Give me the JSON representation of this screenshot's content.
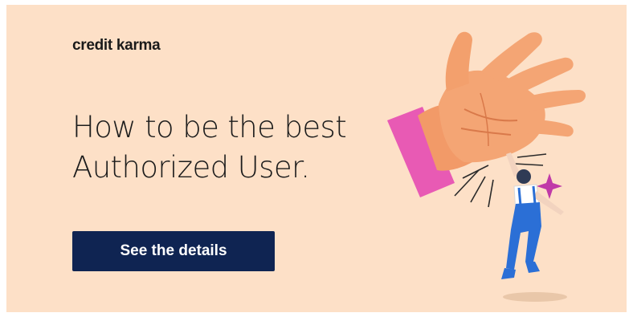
{
  "brand": {
    "logo_text": "credit karma"
  },
  "headline": {
    "line1": "How to be the best",
    "line2": "Authorized User."
  },
  "cta": {
    "label": "See the details"
  },
  "colors": {
    "background": "#fde0c7",
    "button": "#0f2452",
    "sleeve": "#e85ab4",
    "hand": "#f4a070",
    "figure_pants": "#2b6fd6",
    "sparkle": "#c03aa8"
  },
  "illustration": {
    "description_icon": "high-five-hand-and-jumping-person-illustration"
  }
}
